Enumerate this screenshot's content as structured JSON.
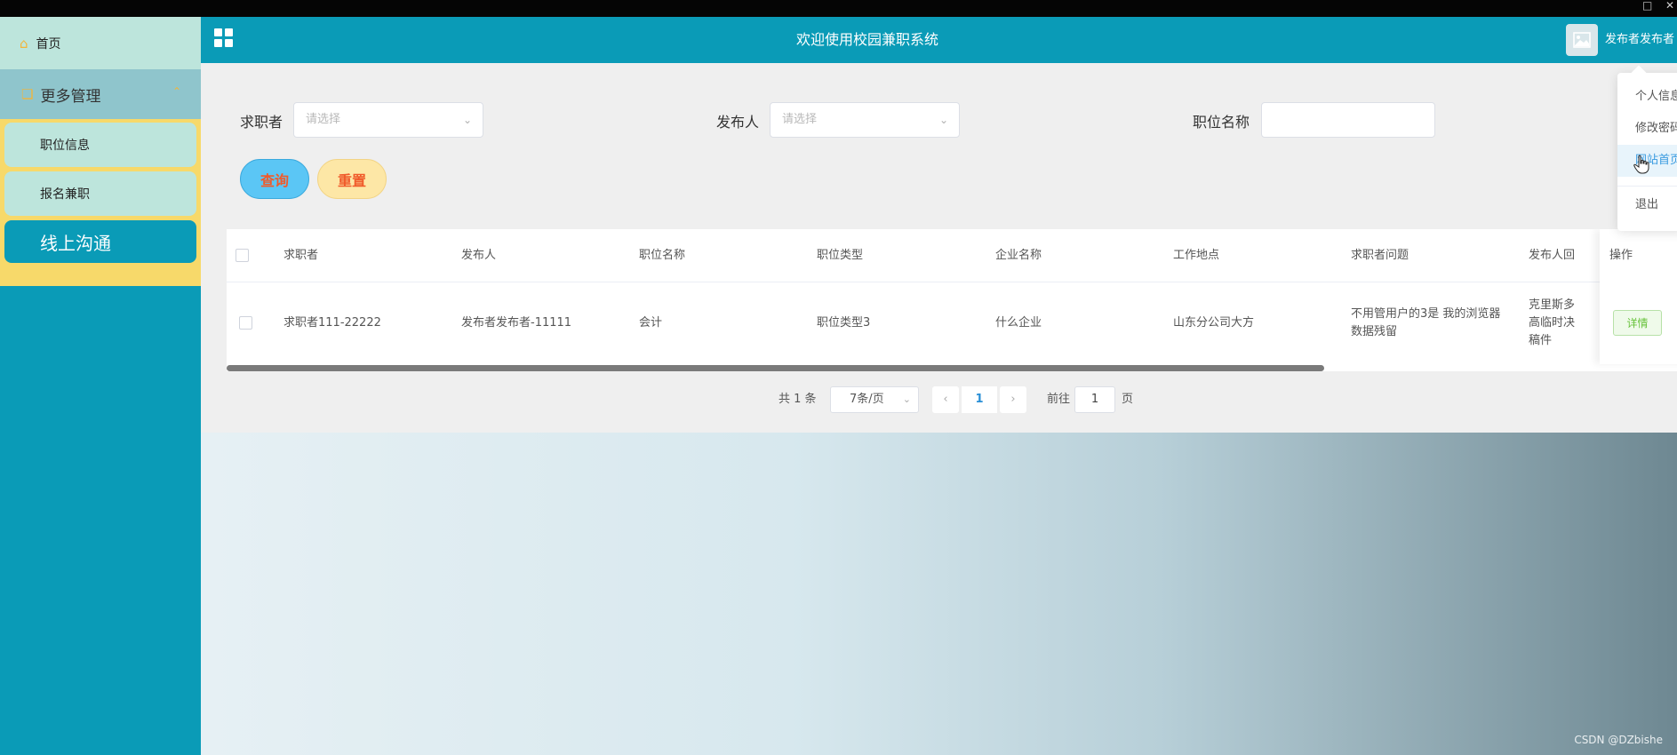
{
  "header": {
    "title": "欢迎使用校园兼职系统",
    "username": "发布者发布者"
  },
  "sidebar": {
    "home": "首页",
    "group": "更多管理",
    "items": [
      {
        "label": "职位信息"
      },
      {
        "label": "报名兼职"
      },
      {
        "label": "线上沟通"
      }
    ]
  },
  "search": {
    "seeker_label": "求职者",
    "seeker_placeholder": "请选择",
    "publisher_label": "发布人",
    "publisher_placeholder": "请选择",
    "job_label": "职位名称",
    "job_value": "",
    "query_button": "查询",
    "reset_button": "重置"
  },
  "table": {
    "columns": [
      "求职者",
      "发布人",
      "职位名称",
      "职位类型",
      "企业名称",
      "工作地点",
      "求职者问题",
      "发布人回",
      "操作"
    ],
    "rows": [
      {
        "seeker": "求职者111-22222",
        "publisher": "发布者发布者-11111",
        "job": "会计",
        "job_type": "职位类型3",
        "company": "什么企业",
        "location": "山东分公司大方",
        "question_line1": "不用管用户的3是 我的浏览器",
        "question_line2": "数据残留",
        "reply_line1": "克里斯多",
        "reply_line2": "高临时决",
        "reply_line3": "稿件",
        "action": "详情"
      }
    ]
  },
  "pagination": {
    "total": "共 1 条",
    "page_size": "7条/页",
    "current_page": "1",
    "goto_label": "前往",
    "goto_value": "1",
    "page_suffix": "页"
  },
  "dropdown": {
    "items": [
      "个人信息",
      "修改密码",
      "网站首页",
      "退出"
    ]
  },
  "watermark": "CSDN @DZbishe"
}
